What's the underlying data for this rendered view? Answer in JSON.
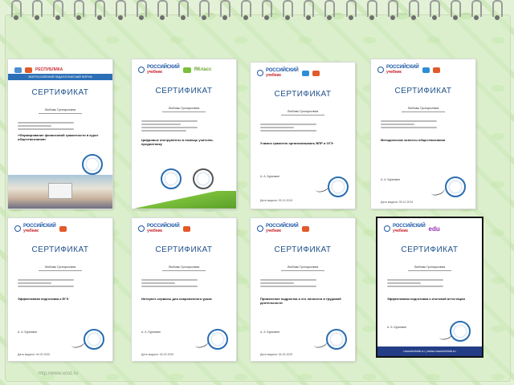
{
  "certificates": [
    {
      "title": "СЕРТИФИКАТ",
      "recipient": "Любовь Григорьевна",
      "topic": "«Формирование финансовой грамотности в курсе обществознания»",
      "logo_label": "РЕСПУБЛИКА"
    },
    {
      "title": "СЕРТИФИКАТ",
      "recipient": "Любовь Григорьевна",
      "topic": "Цифровые инструменты в помощь учителю-предметнику",
      "logo_label": "ЯКласс"
    },
    {
      "title": "СЕРТИФИКАТ",
      "recipient": "Любовь Григорьевна",
      "topic": "Учимся грамотно организовывать ВПР и ОГЭ",
      "logo_label": "российский учебник"
    },
    {
      "title": "СЕРТИФИКАТ",
      "recipient": "Любовь Григорьевна",
      "topic": "Методические аспекты обществознания",
      "logo_label": "российский учебник"
    },
    {
      "title": "СЕРТИФИКАТ",
      "recipient": "Любовь Григорьевна",
      "topic": "Эффективная подготовка к ЕГЭ",
      "logo_label": "российский учебник"
    },
    {
      "title": "СЕРТИФИКАТ",
      "recipient": "Любовь Григорьевна",
      "topic": "Интернет-сервисы для современного урока",
      "logo_label": "российский учебник"
    },
    {
      "title": "СЕРТИФИКАТ",
      "recipient": "Любовь Григорьевна",
      "topic": "Применение подростка и его личности в трудовой деятельности",
      "logo_label": "российский учебник"
    },
    {
      "title": "СЕРТИФИКАТ",
      "recipient": "Любовь Григорьевна",
      "topic": "Эффективная подготовка к итоговой аттестации",
      "logo_label": "российский учебник",
      "footer": "rosuchebnik.ru | www.rosuchebnik.ru"
    }
  ],
  "watermark": "http://www.ucoz.ru",
  "colors": {
    "accent": "#1d4f8a",
    "banner": "#233e87",
    "green": "#7bbf3a"
  }
}
